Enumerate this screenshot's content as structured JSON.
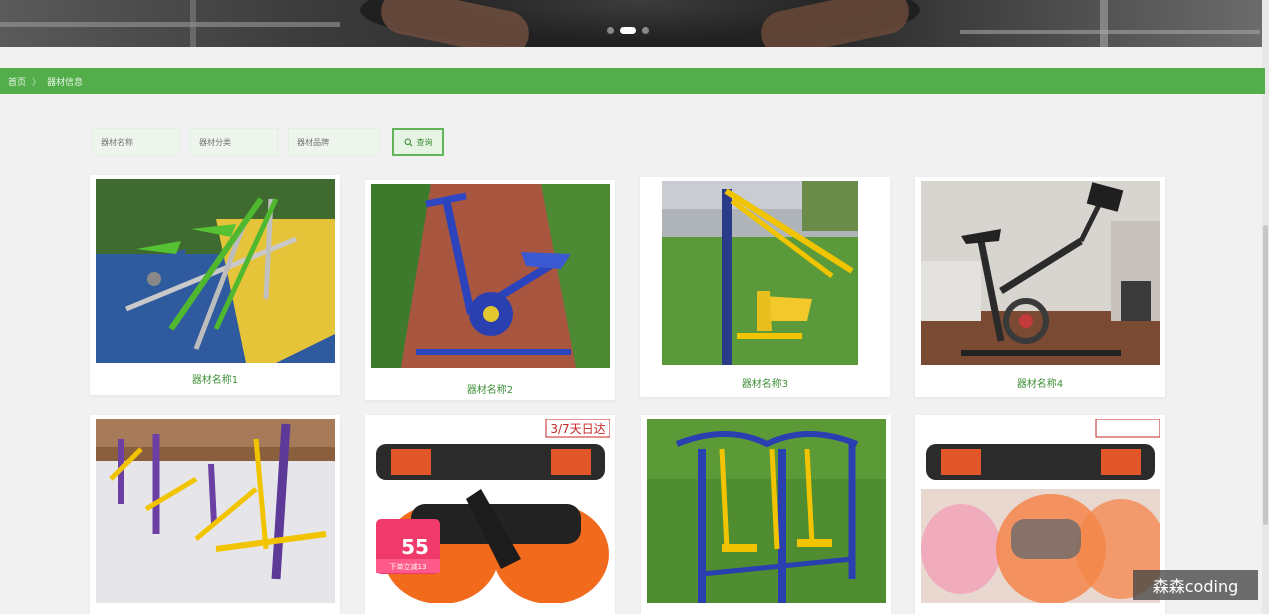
{
  "banner": {
    "slide_count": 3,
    "active_slide": 2
  },
  "breadcrumb": {
    "home": "首页",
    "separator": "〉",
    "current": "器材信息"
  },
  "search": {
    "field1_placeholder": "器材名称",
    "field2_placeholder": "器材分类",
    "field3_placeholder": "器材品牌",
    "button_label": "查询"
  },
  "products": [
    {
      "name": "器材名称1"
    },
    {
      "name": "器材名称2"
    },
    {
      "name": "器材名称3"
    },
    {
      "name": "器材名称4"
    },
    {
      "name": ""
    },
    {
      "name": ""
    },
    {
      "name": ""
    },
    {
      "name": ""
    }
  ],
  "promo": {
    "badge_text": "55",
    "sub_text": "下单立减13",
    "corner_text": "3/7天日达"
  },
  "watermark": "森森coding",
  "colors": {
    "accent_green": "#52ad4a",
    "label_green": "#3f8f39",
    "background": "#f1f1f1"
  }
}
